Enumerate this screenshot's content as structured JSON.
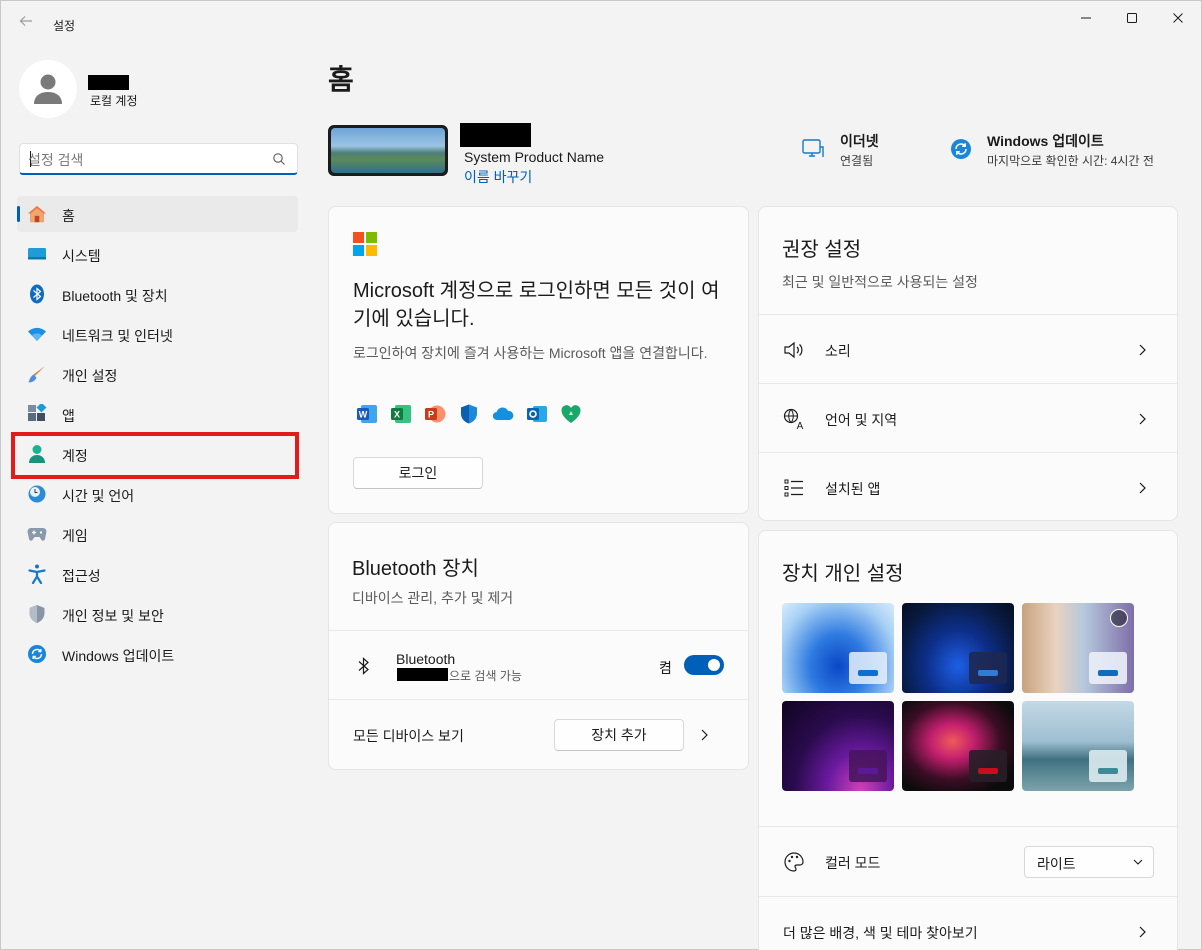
{
  "window": {
    "title": "설정",
    "back_icon": "back-arrow-icon",
    "controls": [
      "minimize-icon",
      "maximize-icon",
      "close-icon"
    ]
  },
  "profile": {
    "account_type": "로컬 계정"
  },
  "search": {
    "placeholder": "설정 검색",
    "icon": "search-icon"
  },
  "nav": {
    "items": [
      {
        "label": "홈",
        "icon": "home-icon",
        "active": true
      },
      {
        "label": "시스템",
        "icon": "system-icon"
      },
      {
        "label": "Bluetooth 및 장치",
        "icon": "bluetooth-icon"
      },
      {
        "label": "네트워크 및 인터넷",
        "icon": "wifi-icon"
      },
      {
        "label": "개인 설정",
        "icon": "brush-icon"
      },
      {
        "label": "앱",
        "icon": "apps-icon"
      },
      {
        "label": "계정",
        "icon": "account-icon",
        "highlighted": true
      },
      {
        "label": "시간 및 언어",
        "icon": "time-language-icon"
      },
      {
        "label": "게임",
        "icon": "gamepad-icon"
      },
      {
        "label": "접근성",
        "icon": "accessibility-icon"
      },
      {
        "label": "개인 정보 및 보안",
        "icon": "shield-icon"
      },
      {
        "label": "Windows 업데이트",
        "icon": "update-icon"
      }
    ]
  },
  "page": {
    "title": "홈"
  },
  "device": {
    "model": "System Product Name",
    "rename_link": "이름 바꾸기"
  },
  "status": {
    "network": {
      "title": "이더넷",
      "sub": "연결됨",
      "icon": "ethernet-icon"
    },
    "update": {
      "title": "Windows 업데이트",
      "sub": "마지막으로 확인한 시간: 4시간 전",
      "icon": "update-icon"
    }
  },
  "ms_card": {
    "heading": "Microsoft 계정으로 로그인하면 모든 것이 여기에 있습니다.",
    "description": "로그인하여 장치에 즐겨 사용하는 Microsoft 앱을 연결합니다.",
    "apps": [
      "word-icon",
      "excel-icon",
      "powerpoint-icon",
      "defender-icon",
      "onedrive-icon",
      "outlook-icon",
      "family-safety-icon"
    ],
    "login_label": "로그인"
  },
  "bt_card": {
    "title": "Bluetooth 장치",
    "subtitle": "디바이스 관리, 추가 및 제거",
    "device_name": "Bluetooth",
    "device_status": "으로 검색 가능",
    "toggle_label": "켬",
    "toggle_on": true,
    "all_devices_label": "모든 디바이스 보기",
    "add_device_label": "장치 추가"
  },
  "recommended": {
    "title": "권장 설정",
    "subtitle": "최근 및 일반적으로 사용되는 설정",
    "items": [
      {
        "label": "소리",
        "icon": "speaker-icon"
      },
      {
        "label": "언어 및 지역",
        "icon": "language-icon"
      },
      {
        "label": "설치된 앱",
        "icon": "list-icon"
      }
    ]
  },
  "personalization": {
    "title": "장치 개인 설정",
    "themes": [
      {
        "accent": "#0b6fd3"
      },
      {
        "accent": "#2f7bd9"
      },
      {
        "accent": "#0f6cbd"
      },
      {
        "accent": "#5a1a96"
      },
      {
        "accent": "#c50f1f"
      },
      {
        "accent": "#3e8a96"
      }
    ],
    "color_mode_label": "컬러 모드",
    "color_mode_value": "라이트",
    "more_label": "더 많은 배경, 색 및 테마 찾아보기"
  },
  "colors": {
    "accent": "#005fb8",
    "highlight_box": "#e21b1b"
  }
}
